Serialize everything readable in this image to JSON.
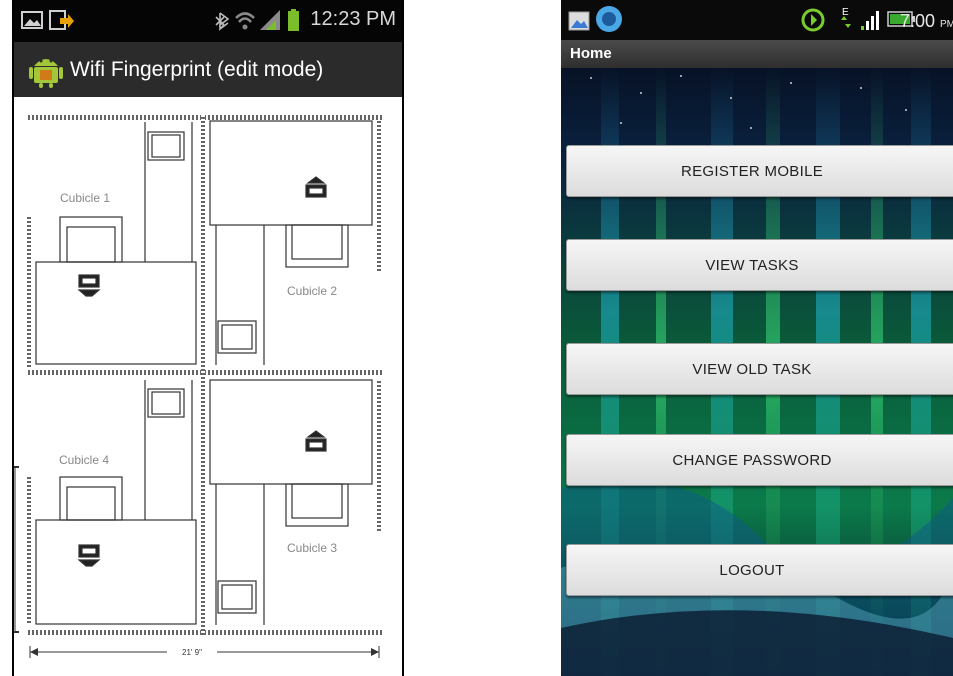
{
  "left_screen": {
    "status_bar": {
      "time": "12:23 PM"
    },
    "app_bar": {
      "title": "Wifi Fingerprint (edit mode)",
      "app_icon": "android-robot-icon"
    },
    "floor_plan": {
      "cubicles": [
        "Cubicle 1",
        "Cubicle 2",
        "Cubicle 4",
        "Cubicle 3"
      ],
      "dimension_label": "21' 9\""
    }
  },
  "right_screen": {
    "status_bar": {
      "time": "7:00",
      "time_suffix": "PM"
    },
    "title_bar": {
      "title": "Home"
    },
    "buttons": [
      {
        "label": "REGISTER MOBILE"
      },
      {
        "label": "VIEW TASKS"
      },
      {
        "label": "VIEW OLD TASK"
      },
      {
        "label": "CHANGE PASSWORD"
      },
      {
        "label": "LOGOUT"
      }
    ]
  },
  "colors": {
    "left_statusbar": "#050505",
    "left_appbar": "#2b2b2b",
    "android_green": "#a4c639",
    "right_titlebar": "#3c3c3c",
    "button_face": "#eaeaea"
  }
}
